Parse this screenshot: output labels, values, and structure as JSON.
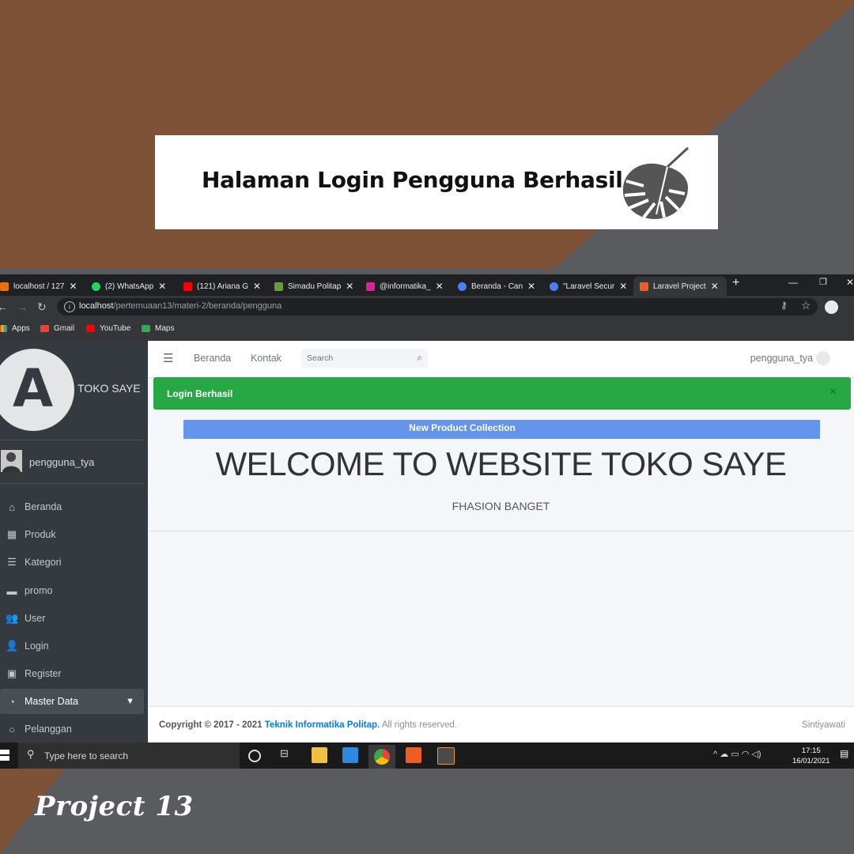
{
  "banner": {
    "title": "Halaman Login Pengguna Berhasil"
  },
  "browser": {
    "tabs": [
      {
        "label": "localhost / 127",
        "color": "#e8710a"
      },
      {
        "label": "(2) WhatsApp",
        "color": "#25d366"
      },
      {
        "label": "(121) Ariana G",
        "color": "#ff0000"
      },
      {
        "label": "Simadu Politap",
        "color": "#6a9a3a"
      },
      {
        "label": "@informatika_",
        "color": "#d6249f"
      },
      {
        "label": "Beranda - Can",
        "color": "#4f7df5"
      },
      {
        "label": "\"Laravel Secur",
        "color": "#4f7df5"
      },
      {
        "label": "Laravel Project",
        "color": "#f05d22"
      }
    ],
    "url_host": "localhost",
    "url_path": "/pertemuaan13/materi-2/beranda/pengguna",
    "bookmarks": [
      "Apps",
      "Gmail",
      "YouTube",
      "Maps"
    ]
  },
  "sidebar": {
    "logo_letter": "A",
    "brand": "TOKO SAYE",
    "user": "pengguna_tya",
    "items": [
      {
        "label": "Beranda",
        "icon": "home-icon"
      },
      {
        "label": "Produk",
        "icon": "grid-icon"
      },
      {
        "label": "Kategori",
        "icon": "list-icon"
      },
      {
        "label": "promo",
        "icon": "wallet-icon"
      },
      {
        "label": "User",
        "icon": "users-icon"
      },
      {
        "label": "Login",
        "icon": "user-icon"
      },
      {
        "label": "Register",
        "icon": "id-card-icon"
      },
      {
        "label": "Master Data",
        "icon": "dashboard-icon"
      },
      {
        "label": "Pelanggan",
        "icon": "circle-icon"
      }
    ]
  },
  "topnav": {
    "links": [
      "Beranda",
      "Kontak"
    ],
    "search_placeholder": "Search",
    "account": "pengguna_tya"
  },
  "alert": {
    "text": "Login Berhasil",
    "close": "×"
  },
  "main": {
    "promo": "New Product Collection",
    "welcome": "WELCOME TO WEBSITE TOKO SAYE",
    "subtitle": "FHASION BANGET"
  },
  "footer": {
    "copyright_prefix": "Copyright © 2017 - 2021",
    "link": "Teknik Informatika Politap.",
    "suffix": "All rights reserved.",
    "author": "Sintiyawati"
  },
  "taskbar": {
    "search_placeholder": "Type here to search",
    "time": "17:15",
    "date": "16/01/2021"
  },
  "caption": "Project 13"
}
